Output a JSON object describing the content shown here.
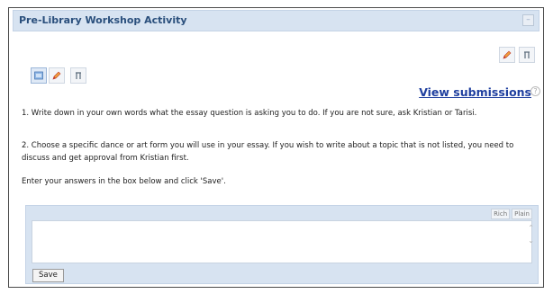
{
  "activity": {
    "title": "Pre-Library Workshop Activity",
    "view_submissions": "View submissions",
    "help_glyph": "?"
  },
  "icons": {
    "collapse": "minus-square-icon",
    "edit": "pencil-icon",
    "tools": "tool-icon",
    "image": "image-icon",
    "help": "help-icon"
  },
  "instructions": [
    "1. Write down in your own words what the essay question is asking you to do. If you are not sure, ask Kristian or Tarisi.",
    "2. Choose a specific dance or art form you will use in your essay. If you wish to write about a topic that is not listed, you need to discuss and get approval from Kristian first.",
    "Enter your answers in the box below and click 'Save'."
  ],
  "editor": {
    "mode_rich": "Rich",
    "mode_plain": "Plain",
    "value": "",
    "save_label": "Save"
  },
  "colors": {
    "header_bg": "#d7e3f1",
    "title_color": "#2a4f7c",
    "link_color": "#1f3f9f"
  }
}
